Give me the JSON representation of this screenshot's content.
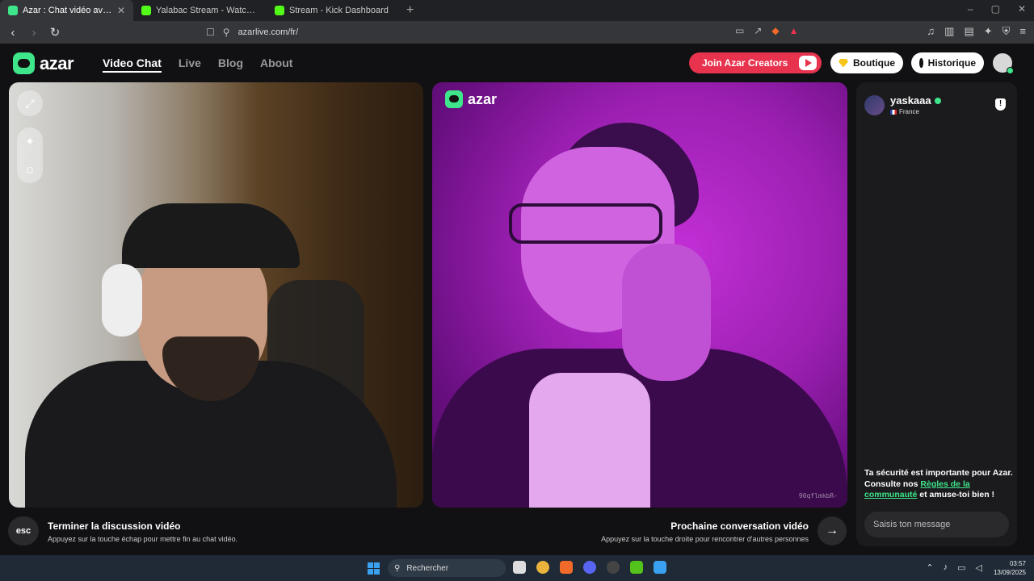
{
  "browser": {
    "tabs": [
      {
        "title": "Azar : Chat vidéo avec de no",
        "active": true,
        "color": "#3fe58a"
      },
      {
        "title": "Yalabac Stream - Watch Live on Kick",
        "active": false,
        "color": "#53fc18"
      },
      {
        "title": "Stream - Kick Dashboard",
        "active": false,
        "color": "#53fc18"
      }
    ],
    "url": "azarlive.com/fr/"
  },
  "site": {
    "logo": "azar",
    "nav": [
      "Video Chat",
      "Live",
      "Blog",
      "About"
    ],
    "creators_label": "Join Azar Creators",
    "boutique_label": "Boutique",
    "historique_label": "Historique",
    "accent": "#3fe58a",
    "creators_color": "#e8334e"
  },
  "video": {
    "watermark": "azar",
    "stranger_code": "90qflmkbR-"
  },
  "controls": {
    "esc_label": "esc",
    "end_title": "Terminer la discussion vidéo",
    "end_sub": "Appuyez sur la touche échap pour mettre fin au chat vidéo.",
    "next_title": "Prochaine conversation vidéo",
    "next_sub": "Appuyez sur la touche droite pour rencontrer d'autres personnes"
  },
  "chat": {
    "username": "yaskaaa",
    "country": "France",
    "safety_part1": "Ta sécurité est importante pour Azar. Consulte nos ",
    "safety_link": "Règles de la communauté",
    "safety_part2": " et amuse-toi bien !",
    "message_placeholder": "Saisis ton message"
  },
  "taskbar": {
    "search_label": "Rechercher",
    "time": "03:57",
    "date": "13/09/2025"
  }
}
